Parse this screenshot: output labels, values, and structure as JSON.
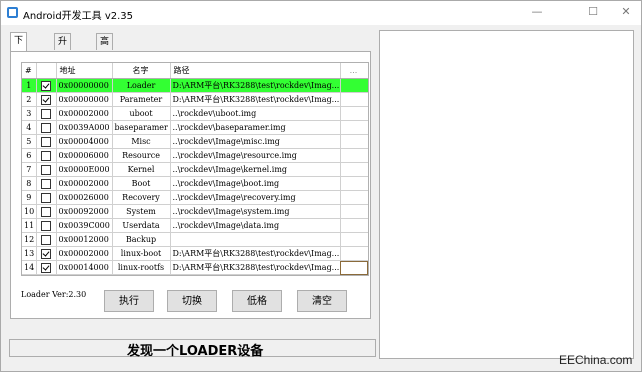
{
  "window": {
    "title": "Android开发工具 v2.35",
    "min_icon": "minimize-icon",
    "max_icon": "maximize-icon",
    "close_icon": "close-icon"
  },
  "tabs": [
    {
      "label": "下载镜像"
    },
    {
      "label": "升级固件"
    },
    {
      "label": "高级功能"
    }
  ],
  "grid": {
    "headers": [
      "#",
      "",
      "地址",
      "名字",
      "路径",
      "..."
    ],
    "rows": [
      {
        "num": "1",
        "checked": true,
        "addr": "0x00000000",
        "name": "Loader",
        "path": "D:\\ARM平台\\RK3288\\test\\rockdev\\Imag..."
      },
      {
        "num": "2",
        "checked": true,
        "addr": "0x00000000",
        "name": "Parameter",
        "path": "D:\\ARM平台\\RK3288\\test\\rockdev\\Imag..."
      },
      {
        "num": "3",
        "checked": false,
        "addr": "0x00002000",
        "name": "uboot",
        "path": "..\\rockdev\\uboot.img"
      },
      {
        "num": "4",
        "checked": false,
        "addr": "0x0039A000",
        "name": "baseparamer",
        "path": "..\\rockdev\\baseparamer.img"
      },
      {
        "num": "5",
        "checked": false,
        "addr": "0x00004000",
        "name": "Misc",
        "path": "..\\rockdev\\Image\\misc.img"
      },
      {
        "num": "6",
        "checked": false,
        "addr": "0x00006000",
        "name": "Resource",
        "path": "..\\rockdev\\Image\\resource.img"
      },
      {
        "num": "7",
        "checked": false,
        "addr": "0x0000E000",
        "name": "Kernel",
        "path": "..\\rockdev\\Image\\kernel.img"
      },
      {
        "num": "8",
        "checked": false,
        "addr": "0x00002000",
        "name": "Boot",
        "path": "..\\rockdev\\Image\\boot.img"
      },
      {
        "num": "9",
        "checked": false,
        "addr": "0x00026000",
        "name": "Recovery",
        "path": "..\\rockdev\\Image\\recovery.img"
      },
      {
        "num": "10",
        "checked": false,
        "addr": "0x00092000",
        "name": "System",
        "path": "..\\rockdev\\Image\\system.img"
      },
      {
        "num": "11",
        "checked": false,
        "addr": "0x0039C000",
        "name": "Userdata",
        "path": "..\\rockdev\\Image\\data.img"
      },
      {
        "num": "12",
        "checked": false,
        "addr": "0x00012000",
        "name": "Backup",
        "path": ""
      },
      {
        "num": "13",
        "checked": true,
        "addr": "0x00002000",
        "name": "linux-boot",
        "path": "D:\\ARM平台\\RK3288\\test\\rockdev\\Imag..."
      },
      {
        "num": "14",
        "checked": true,
        "addr": "0x00014000",
        "name": "linux-rootfs",
        "path": "D:\\ARM平台\\RK3288\\test\\rockdev\\Imag..."
      }
    ]
  },
  "loader_version": "Loader Ver:2.30",
  "buttons": {
    "run": "执行",
    "switch": "切换",
    "erase": "低格",
    "clear": "清空"
  },
  "status_text": "发现一个LOADER设备",
  "watermark": "EEChina.com",
  "colors": {
    "selected_row": "#33ff33"
  }
}
